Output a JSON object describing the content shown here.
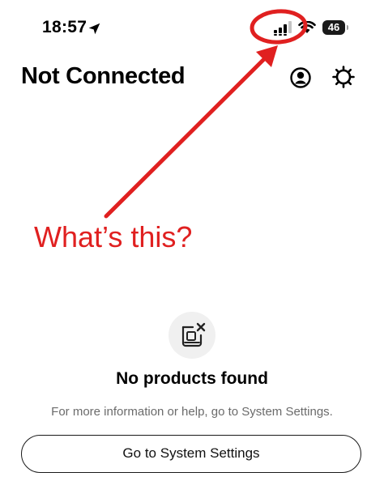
{
  "status_bar": {
    "time": "18:57",
    "battery": "46",
    "icons": [
      "location-arrow-icon",
      "cellular-signal-icon",
      "wifi-icon",
      "battery-icon"
    ]
  },
  "header": {
    "title": "Not Connected",
    "icons": [
      "account-icon",
      "gear-icon"
    ]
  },
  "annotation": {
    "text": "What’s this?",
    "color": "#e02020"
  },
  "empty_state": {
    "icon": "no-product-icon",
    "title": "No products found",
    "description": "For more information or help, go to System Settings.",
    "button_label": "Go to System Settings"
  }
}
